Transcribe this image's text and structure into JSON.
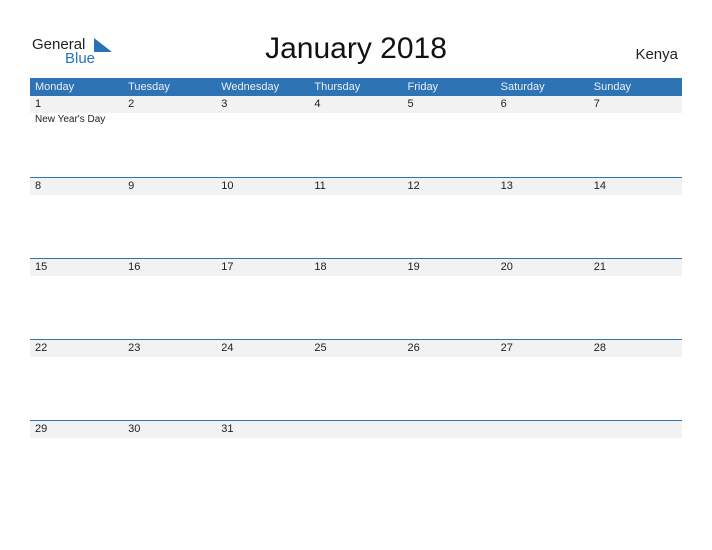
{
  "logo": {
    "general": "General",
    "blue": "Blue"
  },
  "title": "January 2018",
  "country": "Kenya",
  "colors": {
    "accent": "#2e74b5",
    "row_bg": "#f2f2f2"
  },
  "weekdays": [
    "Monday",
    "Tuesday",
    "Wednesday",
    "Thursday",
    "Friday",
    "Saturday",
    "Sunday"
  ],
  "weeks": [
    {
      "days": [
        "1",
        "2",
        "3",
        "4",
        "5",
        "6",
        "7"
      ],
      "events": [
        "New Year's Day",
        "",
        "",
        "",
        "",
        "",
        ""
      ]
    },
    {
      "days": [
        "8",
        "9",
        "10",
        "11",
        "12",
        "13",
        "14"
      ],
      "events": [
        "",
        "",
        "",
        "",
        "",
        "",
        ""
      ]
    },
    {
      "days": [
        "15",
        "16",
        "17",
        "18",
        "19",
        "20",
        "21"
      ],
      "events": [
        "",
        "",
        "",
        "",
        "",
        "",
        ""
      ]
    },
    {
      "days": [
        "22",
        "23",
        "24",
        "25",
        "26",
        "27",
        "28"
      ],
      "events": [
        "",
        "",
        "",
        "",
        "",
        "",
        ""
      ]
    },
    {
      "days": [
        "29",
        "30",
        "31",
        "",
        "",
        "",
        ""
      ],
      "events": [
        "",
        "",
        "",
        "",
        "",
        "",
        ""
      ]
    }
  ]
}
